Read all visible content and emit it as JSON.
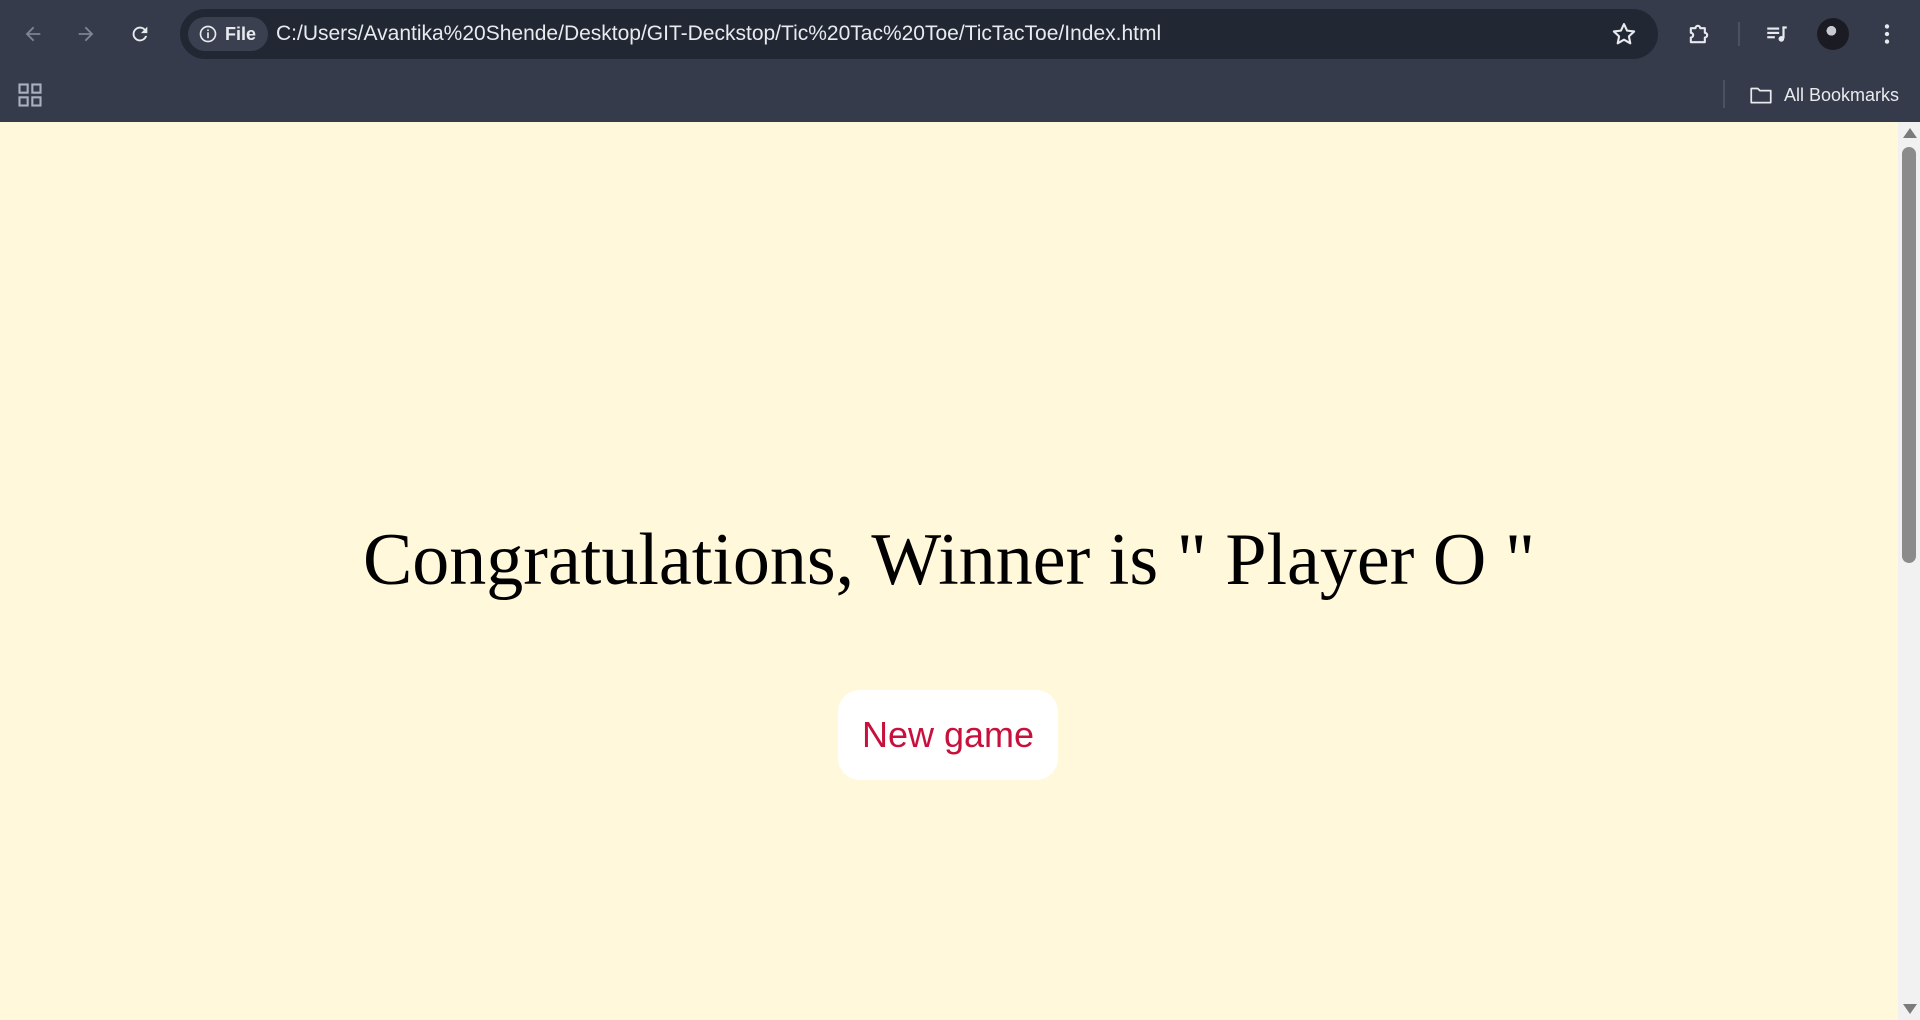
{
  "browser": {
    "site_chip_label": "File",
    "url": "C:/Users/Avantika%20Shende/Desktop/GIT-Deckstop/Tic%20Tac%20Toe/TicTacToe/Index.html",
    "bookmarks_label": "All Bookmarks"
  },
  "page": {
    "winner_message": "Congratulations, Winner is \" Player O \"",
    "new_game_label": "New game"
  },
  "colors": {
    "page_background": "#fff8db",
    "button_text": "#c8103c",
    "chrome_background": "#353b4b"
  }
}
